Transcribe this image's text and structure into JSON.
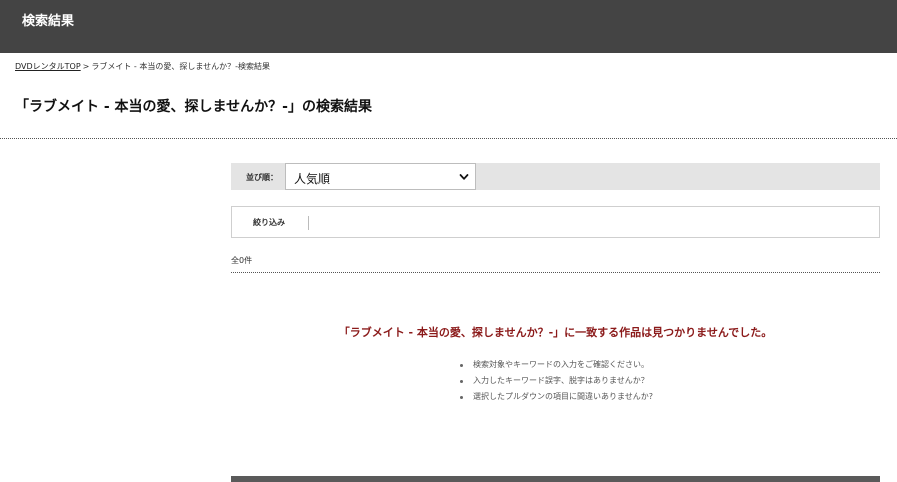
{
  "header": {
    "title": "検索結果"
  },
  "breadcrumb": {
    "home": "DVDレンタルTOP",
    "separator": ">",
    "current": "ラブメイト - 本当の愛、探しませんか？-検索結果"
  },
  "page_title": "「ラブメイト - 本当の愛、探しませんか？-」の検索結果",
  "sort": {
    "label": "並び順：",
    "selected": "人気順"
  },
  "filter": {
    "label": "絞り込み"
  },
  "result_count": "全0件",
  "not_found_message": "「ラブメイト - 本当の愛、探しませんか？-」に一致する作品は見つかりませんでした。",
  "tips": [
    "検索対象やキーワードの入力をご確認ください。",
    "入力したキーワード誤字、脱字はありませんか？",
    "選択したプルダウンの項目に間違いありませんか?"
  ],
  "colors": {
    "header_bg": "#444444",
    "not_found_text": "#8b1a1a",
    "sortbar_bg": "#e4e4e4"
  }
}
